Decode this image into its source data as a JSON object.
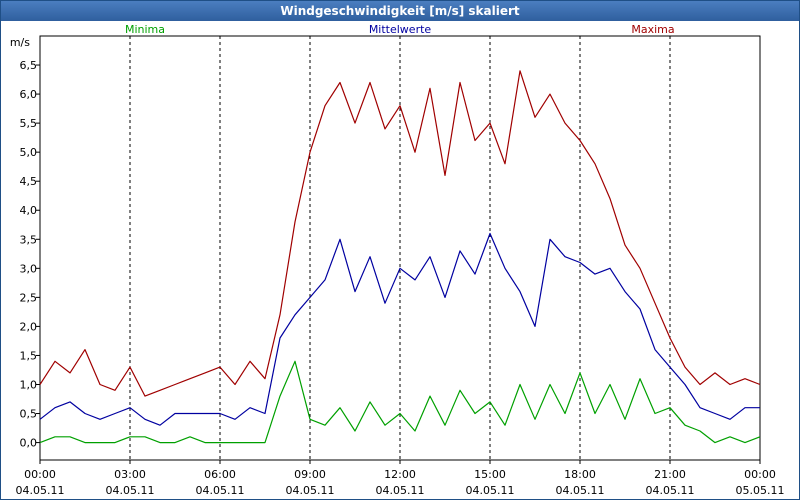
{
  "window": {
    "title": "Windgeschwindigkeit [m/s] skaliert"
  },
  "chart_data": {
    "type": "line",
    "title": "Windgeschwindigkeit [m/s] skaliert",
    "ylabel": "m/s",
    "xlabel": "",
    "ylim": [
      -0.3,
      7.0
    ],
    "xlim": [
      0,
      24
    ],
    "y_ticks": [
      "0,0",
      "0,5",
      "1,0",
      "1,5",
      "2,0",
      "2,5",
      "3,0",
      "3,5",
      "4,0",
      "4,5",
      "5,0",
      "5,5",
      "6,0",
      "6,5"
    ],
    "x_ticks": [
      {
        "time": "00:00",
        "date": "04.05.11"
      },
      {
        "time": "03:00",
        "date": "04.05.11"
      },
      {
        "time": "06:00",
        "date": "04.05.11"
      },
      {
        "time": "09:00",
        "date": "04.05.11"
      },
      {
        "time": "12:00",
        "date": "04.05.11"
      },
      {
        "time": "15:00",
        "date": "04.05.11"
      },
      {
        "time": "18:00",
        "date": "04.05.11"
      },
      {
        "time": "21:00",
        "date": "04.05.11"
      },
      {
        "time": "00:00",
        "date": "05.05.11"
      }
    ],
    "grid": "dashed vertical every 3 h",
    "legend": [
      "Minima",
      "Mittelwerte",
      "Maxima"
    ],
    "x_hours": [
      0,
      0.5,
      1,
      1.5,
      2,
      2.5,
      3,
      3.5,
      4,
      4.5,
      5,
      5.5,
      6,
      6.5,
      7,
      7.5,
      8,
      8.5,
      9,
      9.5,
      10,
      10.5,
      11,
      11.5,
      12,
      12.5,
      13,
      13.5,
      14,
      14.5,
      15,
      15.5,
      16,
      16.5,
      17,
      17.5,
      18,
      18.5,
      19,
      19.5,
      20,
      20.5,
      21,
      21.5,
      22,
      22.5,
      23,
      23.5,
      24
    ],
    "series": [
      {
        "name": "Minima",
        "color": "#00a000",
        "values": [
          0,
          0.1,
          0.1,
          0,
          0,
          0,
          0.1,
          0.1,
          0,
          0,
          0.1,
          0,
          0,
          0,
          0,
          0,
          0.8,
          1.4,
          0.4,
          0.3,
          0.6,
          0.2,
          0.7,
          0.3,
          0.5,
          0.2,
          0.8,
          0.3,
          0.9,
          0.5,
          0.7,
          0.3,
          1.0,
          0.4,
          1.0,
          0.5,
          1.2,
          0.5,
          1.0,
          0.4,
          1.1,
          0.5,
          0.6,
          0.3,
          0.2,
          0,
          0.1,
          0,
          0.1
        ]
      },
      {
        "name": "Mittelwerte",
        "color": "#0000a0",
        "values": [
          0.4,
          0.6,
          0.7,
          0.5,
          0.4,
          0.5,
          0.6,
          0.4,
          0.3,
          0.5,
          0.5,
          0.5,
          0.5,
          0.4,
          0.6,
          0.5,
          1.8,
          2.2,
          2.5,
          2.8,
          3.5,
          2.6,
          3.2,
          2.4,
          3.0,
          2.8,
          3.2,
          2.5,
          3.3,
          2.9,
          3.6,
          3.0,
          2.6,
          2.0,
          3.5,
          3.2,
          3.1,
          2.9,
          3.0,
          2.6,
          2.3,
          1.6,
          1.3,
          1.0,
          0.6,
          0.5,
          0.4,
          0.6,
          0.6
        ]
      },
      {
        "name": "Maxima",
        "color": "#a00000",
        "values": [
          1.0,
          1.4,
          1.2,
          1.6,
          1.0,
          0.9,
          1.3,
          0.8,
          0.9,
          1.0,
          1.1,
          1.2,
          1.3,
          1.0,
          1.4,
          1.1,
          2.2,
          3.8,
          5.0,
          5.8,
          6.2,
          5.5,
          6.2,
          5.4,
          5.8,
          5.0,
          6.1,
          4.6,
          6.2,
          5.2,
          5.5,
          4.8,
          6.4,
          5.6,
          6.0,
          5.5,
          5.2,
          4.8,
          4.2,
          3.4,
          3.0,
          2.4,
          1.8,
          1.3,
          1.0,
          1.2,
          1.0,
          1.1,
          1.0
        ]
      }
    ]
  }
}
